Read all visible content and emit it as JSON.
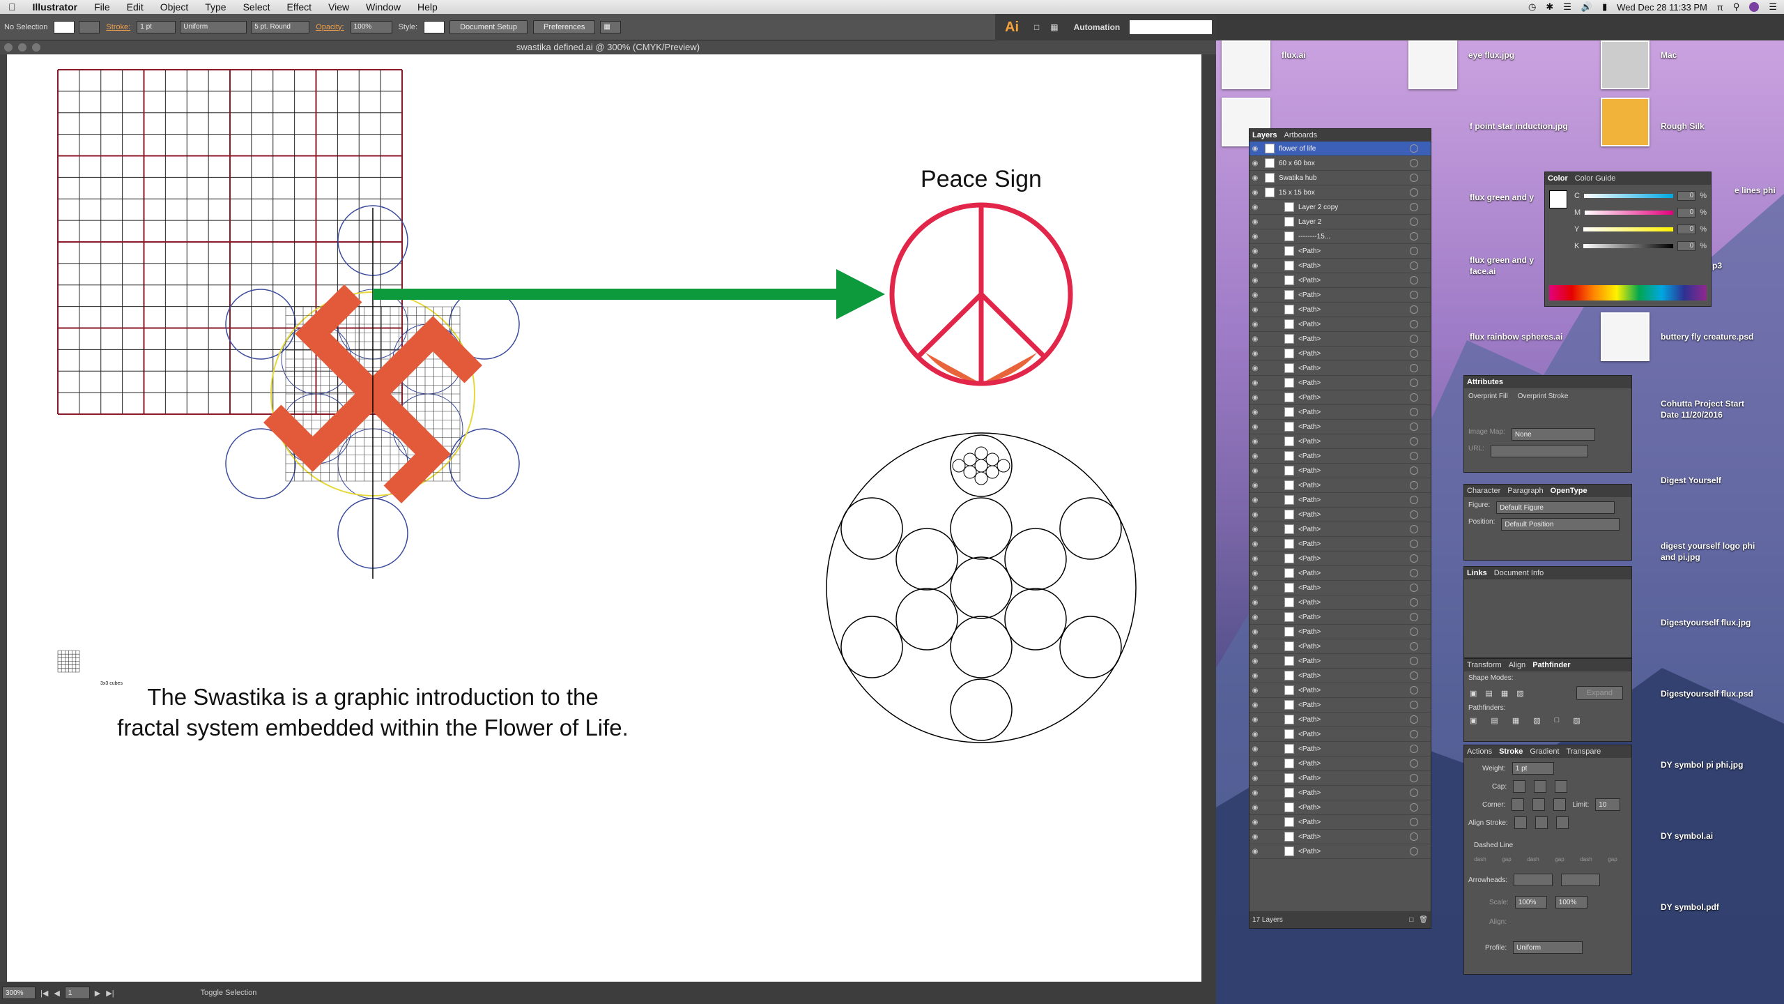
{
  "menubar": {
    "apple": "",
    "items": [
      "Illustrator",
      "File",
      "Edit",
      "Object",
      "Type",
      "Select",
      "Effect",
      "View",
      "Window",
      "Help"
    ],
    "clock": "Wed Dec 28  11:33 PM",
    "pi": "π"
  },
  "control": {
    "selection": "No Selection",
    "stroke_label": "Stroke:",
    "stroke_value": "1 pt",
    "uniform": "Uniform",
    "brush": "5 pt. Round",
    "opacity_label": "Opacity:",
    "opacity_value": "100%",
    "style_label": "Style:",
    "doc_setup": "Document Setup",
    "preferences": "Preferences"
  },
  "appbar": {
    "logo": "Ai",
    "workspace": "Automation"
  },
  "document": {
    "title": "swastika defined.ai @ 300% (CMYK/Preview)",
    "caption_line1": "The Swastika is a graphic introduction to the",
    "caption_line2": "fractal system embedded within the Flower of Life.",
    "peace_title": "Peace Sign",
    "grid_label": "3x3 cubes"
  },
  "status": {
    "zoom": "300%",
    "page": "1",
    "toggle": "Toggle Selection"
  },
  "layers_panel": {
    "tabs": [
      "Layers",
      "Artboards"
    ],
    "rows": [
      {
        "name": "flower of life",
        "selected": true
      },
      {
        "name": "60 x 60 box"
      },
      {
        "name": "Swatika hub"
      },
      {
        "name": "15 x 15 box"
      },
      {
        "name": "Layer 2 copy"
      },
      {
        "name": "Layer 2"
      },
      {
        "name": "--------15..."
      },
      {
        "name": "<Path>"
      },
      {
        "name": "<Path>"
      },
      {
        "name": "<Path>"
      },
      {
        "name": "<Path>"
      },
      {
        "name": "<Path>"
      },
      {
        "name": "<Path>"
      },
      {
        "name": "<Path>"
      },
      {
        "name": "<Path>"
      },
      {
        "name": "<Path>"
      },
      {
        "name": "<Path>"
      },
      {
        "name": "<Path>"
      },
      {
        "name": "<Path>"
      },
      {
        "name": "<Path>"
      },
      {
        "name": "<Path>"
      },
      {
        "name": "<Path>"
      },
      {
        "name": "<Path>"
      },
      {
        "name": "<Path>"
      },
      {
        "name": "<Path>"
      },
      {
        "name": "<Path>"
      },
      {
        "name": "<Path>"
      },
      {
        "name": "<Path>"
      },
      {
        "name": "<Path>"
      },
      {
        "name": "<Path>"
      },
      {
        "name": "<Path>"
      },
      {
        "name": "<Path>"
      },
      {
        "name": "<Path>"
      },
      {
        "name": "<Path>"
      },
      {
        "name": "<Path>"
      },
      {
        "name": "<Path>"
      },
      {
        "name": "<Path>"
      },
      {
        "name": "<Path>"
      },
      {
        "name": "<Path>"
      },
      {
        "name": "<Path>"
      },
      {
        "name": "<Path>"
      },
      {
        "name": "<Path>"
      },
      {
        "name": "<Path>"
      },
      {
        "name": "<Path>"
      },
      {
        "name": "<Path>"
      },
      {
        "name": "<Path>"
      },
      {
        "name": "<Path>"
      },
      {
        "name": "<Path>"
      },
      {
        "name": "<Path>"
      }
    ],
    "footer": "17 Layers"
  },
  "color_panel": {
    "tabs": [
      "Color",
      "Color Guide"
    ],
    "channels": [
      {
        "label": "C",
        "value": "0"
      },
      {
        "label": "M",
        "value": "0"
      },
      {
        "label": "Y",
        "value": "0"
      },
      {
        "label": "K",
        "value": "0"
      }
    ],
    "pct": "%"
  },
  "attributes_panel": {
    "title": "Attributes",
    "overprint_fill": "Overprint Fill",
    "overprint_stroke": "Overprint Stroke",
    "image_map": "Image Map:",
    "image_map_value": "None",
    "url": "URL:"
  },
  "opentype_panel": {
    "tabs": [
      "Character",
      "Paragraph",
      "OpenType"
    ],
    "figure_label": "Figure:",
    "figure_value": "Default Figure",
    "position_label": "Position:",
    "position_value": "Default Position"
  },
  "links_panel": {
    "tabs": [
      "Links",
      "Document Info"
    ]
  },
  "pathfinder_panel": {
    "tabs": [
      "Transform",
      "Align",
      "Pathfinder"
    ],
    "shape_modes": "Shape Modes:",
    "expand": "Expand",
    "pathfinders": "Pathfinders:"
  },
  "stroke_panel": {
    "tabs": [
      "Actions",
      "Stroke",
      "Gradient",
      "Transpare"
    ],
    "weight_label": "Weight:",
    "weight_value": "1 pt",
    "cap_label": "Cap:",
    "corner_label": "Corner:",
    "limit_label": "Limit:",
    "limit_value": "10",
    "align_label": "Align Stroke:",
    "dashed": "Dashed Line",
    "dash_labels": [
      "dash",
      "gap",
      "dash",
      "gap",
      "dash",
      "gap"
    ],
    "arrowheads": "Arrowheads:",
    "scale": "Scale:",
    "scale_value": "100%",
    "align": "Align:",
    "profile": "Profile:",
    "profile_value": "Uniform"
  },
  "desktop": {
    "items": [
      {
        "label": "flux.ai"
      },
      {
        "label": "eye flux.jpg"
      },
      {
        "label": "Mac"
      },
      {
        "label": "f point star induction.jpg"
      },
      {
        "label": "Rough Silk"
      },
      {
        "label": "flux green and y"
      },
      {
        "label": "e lines phi"
      },
      {
        "label": "flux green and y"
      },
      {
        "label": "face.ai"
      },
      {
        "label": "p3"
      },
      {
        "label": "flux rainbow spheres.ai"
      },
      {
        "label": "buttery fly creature.psd"
      },
      {
        "label": "Cohutta Project Start"
      },
      {
        "label": "Date 11/20/2016"
      },
      {
        "label": "Digest Yourself"
      },
      {
        "label": "digest yourself logo phi"
      },
      {
        "label": "and pi.jpg"
      },
      {
        "label": "Digestyourself flux.jpg"
      },
      {
        "label": "Digestyourself flux.psd"
      },
      {
        "label": "DY symbol pi phi.jpg"
      },
      {
        "label": "DY symbol.ai"
      },
      {
        "label": "DY symbol.pdf"
      }
    ]
  },
  "colors": {
    "swastika": "#e35a3a",
    "peace_ring": "#e2264a",
    "peace_fill": "#e8643a",
    "arrow": "#0c9a3c",
    "grid_dark": "#8b1a28",
    "circle_blue": "#3a4a9c",
    "circle_yellow": "#e6d839"
  }
}
